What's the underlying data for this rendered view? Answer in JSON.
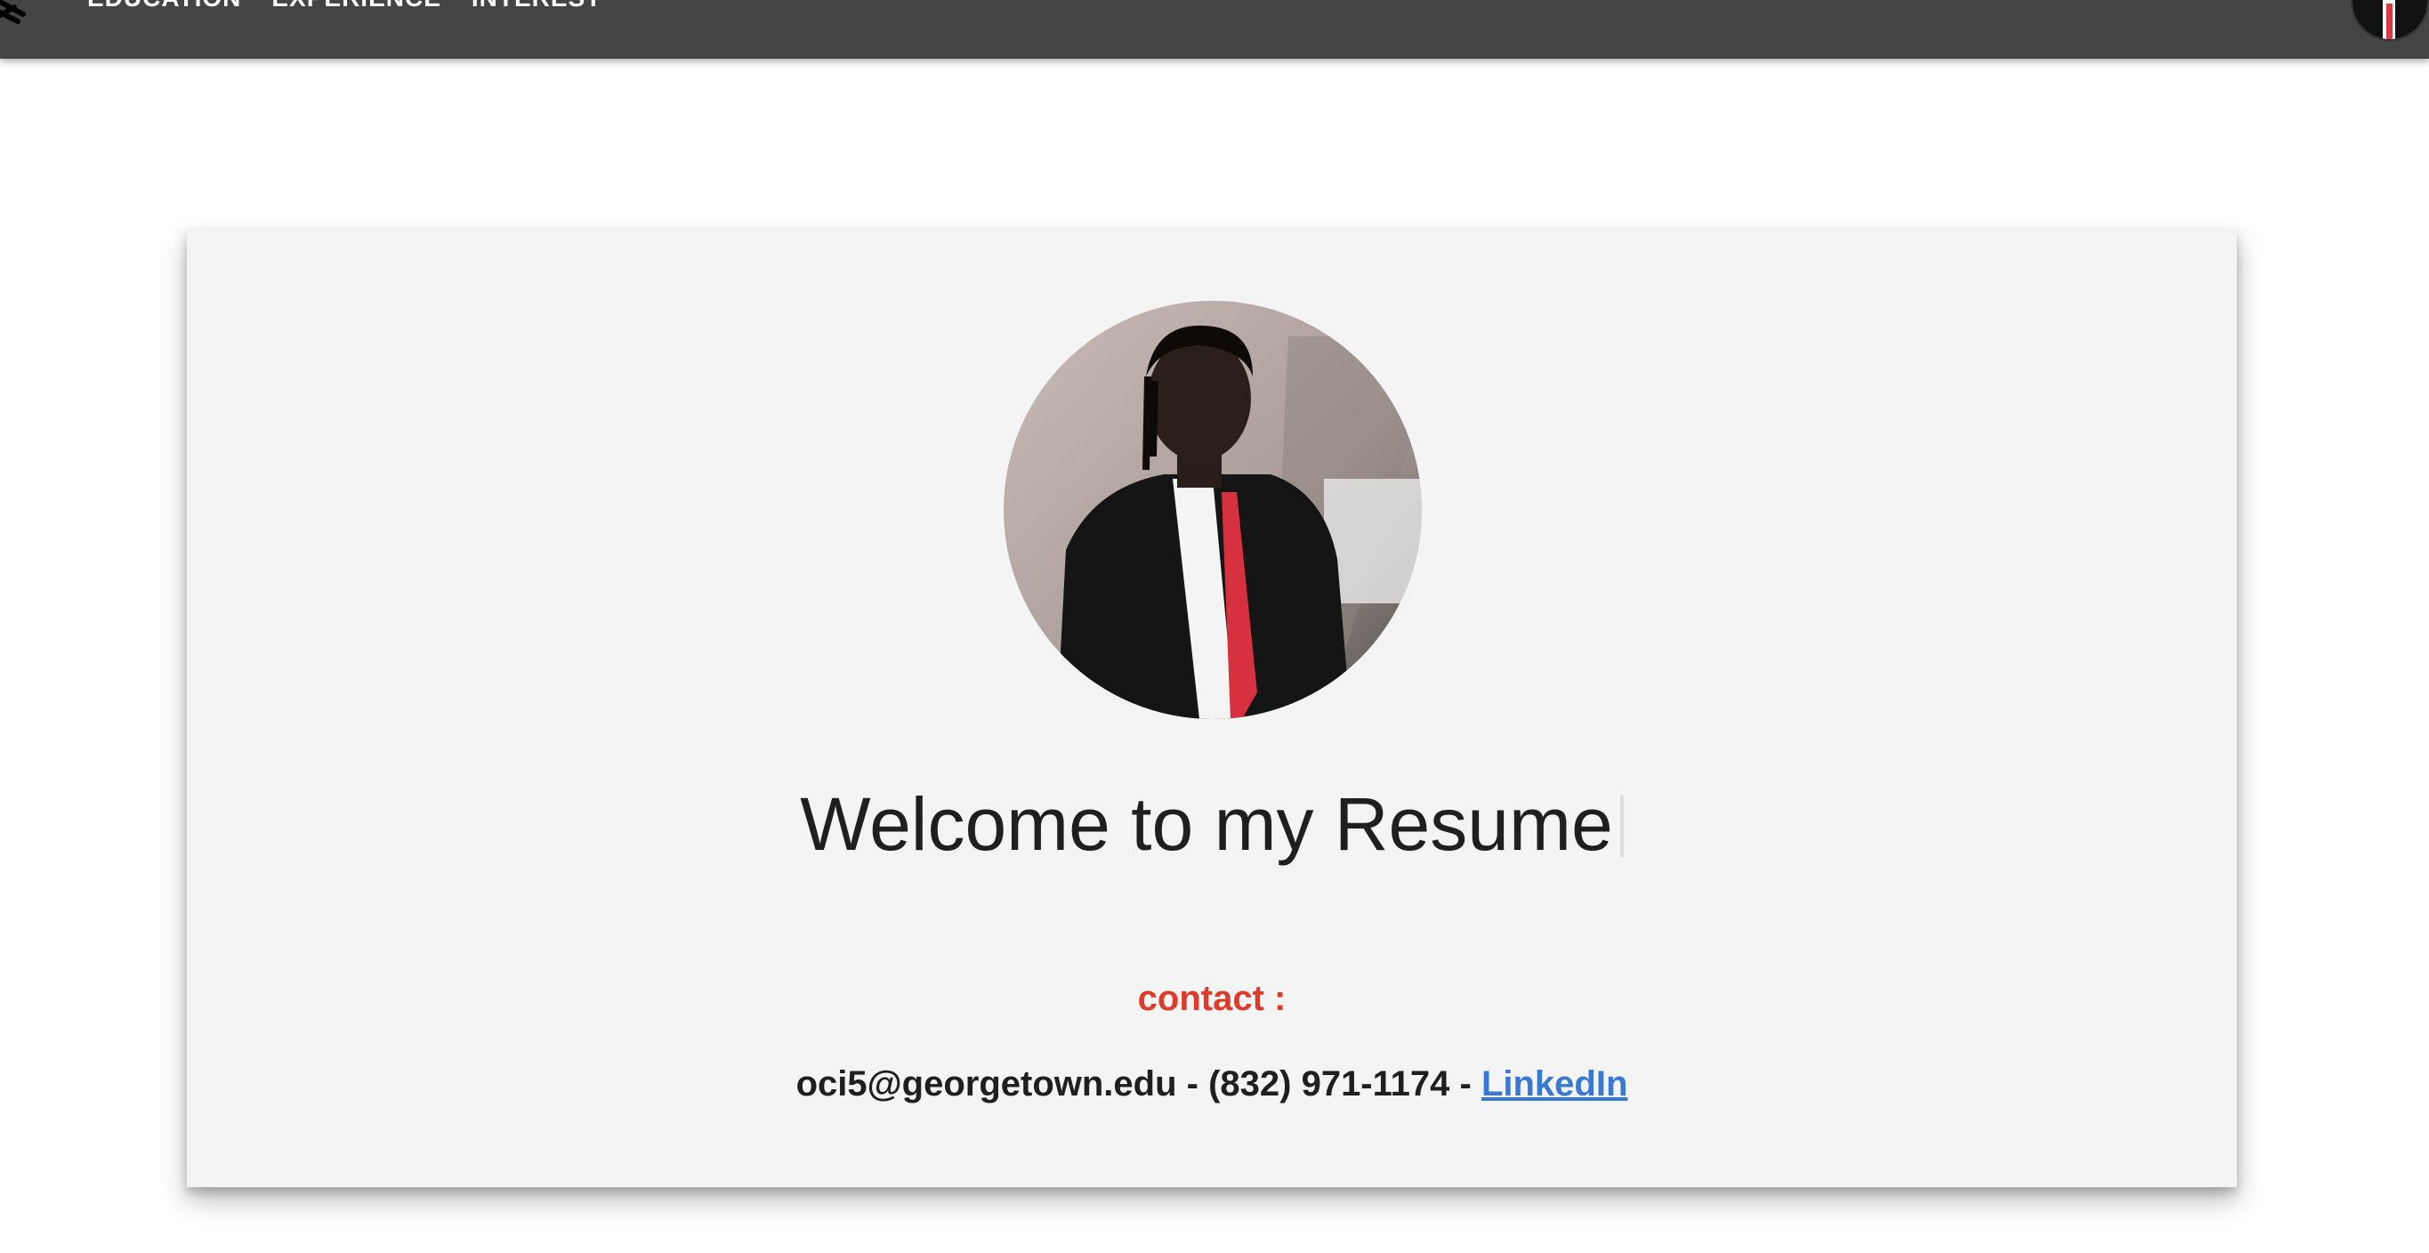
{
  "nav": {
    "logo_icon": "brand-scribble-icon",
    "items": [
      {
        "label": "EDUCATION"
      },
      {
        "label": "EXPERIENCE"
      },
      {
        "label": "INTEREST"
      }
    ]
  },
  "hero": {
    "title": "Welcome to my Resume",
    "contact_label": "contact :",
    "email": "oci5@georgetown.edu",
    "separator": " - ",
    "phone": "(832) 971-1174",
    "linkedin_label": "LinkedIn"
  },
  "colors": {
    "navbar": "#444444",
    "card_bg": "#f4f4f4",
    "contact_label": "#e03a2b",
    "link": "#3a78d6"
  }
}
